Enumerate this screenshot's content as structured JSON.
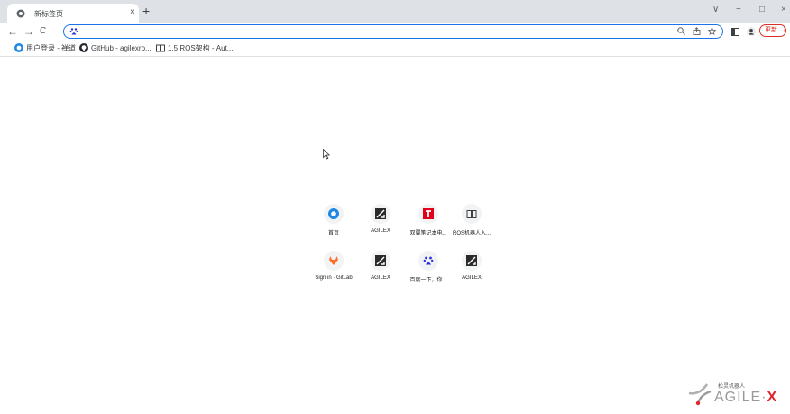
{
  "tab": {
    "title": "新标签页",
    "close": "×"
  },
  "new_tab": "+",
  "window_controls": {
    "dropdown": "∨",
    "minimize": "−",
    "restore": "□",
    "close": "×"
  },
  "nav": {
    "back": "←",
    "forward": "→",
    "reload": "C"
  },
  "omnibox": {
    "value": "",
    "placeholder": ""
  },
  "toolbar": {
    "update_label": "更新"
  },
  "bookmarks": [
    {
      "label": "用户登录 - 禅道",
      "icon": "zentao-icon"
    },
    {
      "label": "GitHub - agilexro...",
      "icon": "github-icon"
    },
    {
      "label": "1.5 ROS架构 - Aut...",
      "icon": "book-icon"
    }
  ],
  "shortcuts": [
    {
      "label": "首页",
      "icon": "zentao-icon"
    },
    {
      "label": "AGILEX",
      "icon": "agilex-icon"
    },
    {
      "label": "双翼笔记本电...",
      "icon": "t-icon"
    },
    {
      "label": "ROS机器人入...",
      "icon": "book-icon"
    },
    {
      "label": "Sign in · GitLab",
      "icon": "gitlab-icon"
    },
    {
      "label": "AGILEX",
      "icon": "agilex-icon"
    },
    {
      "label": "百度一下，你...",
      "icon": "baidu-icon"
    },
    {
      "label": "AGILEX",
      "icon": "agilex-icon"
    }
  ],
  "logo": {
    "chinese": "松灵机器人",
    "brand": "AGILE·",
    "brand_x": "X"
  },
  "colors": {
    "accent": "#1a73e8",
    "update": "#d93025",
    "brand_red": "#e0252d"
  }
}
